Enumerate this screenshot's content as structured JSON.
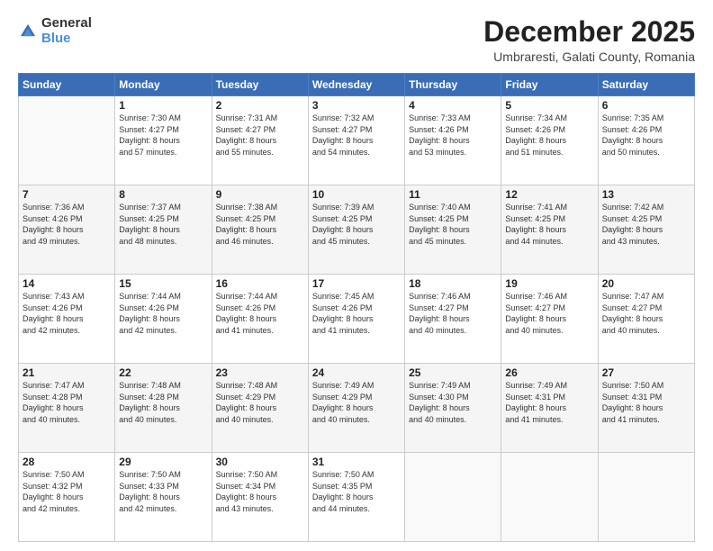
{
  "logo": {
    "general": "General",
    "blue": "Blue"
  },
  "title": "December 2025",
  "location": "Umbraresti, Galati County, Romania",
  "weekdays": [
    "Sunday",
    "Monday",
    "Tuesday",
    "Wednesday",
    "Thursday",
    "Friday",
    "Saturday"
  ],
  "weeks": [
    [
      {
        "day": "",
        "info": ""
      },
      {
        "day": "1",
        "info": "Sunrise: 7:30 AM\nSunset: 4:27 PM\nDaylight: 8 hours\nand 57 minutes."
      },
      {
        "day": "2",
        "info": "Sunrise: 7:31 AM\nSunset: 4:27 PM\nDaylight: 8 hours\nand 55 minutes."
      },
      {
        "day": "3",
        "info": "Sunrise: 7:32 AM\nSunset: 4:27 PM\nDaylight: 8 hours\nand 54 minutes."
      },
      {
        "day": "4",
        "info": "Sunrise: 7:33 AM\nSunset: 4:26 PM\nDaylight: 8 hours\nand 53 minutes."
      },
      {
        "day": "5",
        "info": "Sunrise: 7:34 AM\nSunset: 4:26 PM\nDaylight: 8 hours\nand 51 minutes."
      },
      {
        "day": "6",
        "info": "Sunrise: 7:35 AM\nSunset: 4:26 PM\nDaylight: 8 hours\nand 50 minutes."
      }
    ],
    [
      {
        "day": "7",
        "info": "Sunrise: 7:36 AM\nSunset: 4:26 PM\nDaylight: 8 hours\nand 49 minutes."
      },
      {
        "day": "8",
        "info": "Sunrise: 7:37 AM\nSunset: 4:25 PM\nDaylight: 8 hours\nand 48 minutes."
      },
      {
        "day": "9",
        "info": "Sunrise: 7:38 AM\nSunset: 4:25 PM\nDaylight: 8 hours\nand 46 minutes."
      },
      {
        "day": "10",
        "info": "Sunrise: 7:39 AM\nSunset: 4:25 PM\nDaylight: 8 hours\nand 45 minutes."
      },
      {
        "day": "11",
        "info": "Sunrise: 7:40 AM\nSunset: 4:25 PM\nDaylight: 8 hours\nand 45 minutes."
      },
      {
        "day": "12",
        "info": "Sunrise: 7:41 AM\nSunset: 4:25 PM\nDaylight: 8 hours\nand 44 minutes."
      },
      {
        "day": "13",
        "info": "Sunrise: 7:42 AM\nSunset: 4:25 PM\nDaylight: 8 hours\nand 43 minutes."
      }
    ],
    [
      {
        "day": "14",
        "info": "Sunrise: 7:43 AM\nSunset: 4:26 PM\nDaylight: 8 hours\nand 42 minutes."
      },
      {
        "day": "15",
        "info": "Sunrise: 7:44 AM\nSunset: 4:26 PM\nDaylight: 8 hours\nand 42 minutes."
      },
      {
        "day": "16",
        "info": "Sunrise: 7:44 AM\nSunset: 4:26 PM\nDaylight: 8 hours\nand 41 minutes."
      },
      {
        "day": "17",
        "info": "Sunrise: 7:45 AM\nSunset: 4:26 PM\nDaylight: 8 hours\nand 41 minutes."
      },
      {
        "day": "18",
        "info": "Sunrise: 7:46 AM\nSunset: 4:27 PM\nDaylight: 8 hours\nand 40 minutes."
      },
      {
        "day": "19",
        "info": "Sunrise: 7:46 AM\nSunset: 4:27 PM\nDaylight: 8 hours\nand 40 minutes."
      },
      {
        "day": "20",
        "info": "Sunrise: 7:47 AM\nSunset: 4:27 PM\nDaylight: 8 hours\nand 40 minutes."
      }
    ],
    [
      {
        "day": "21",
        "info": "Sunrise: 7:47 AM\nSunset: 4:28 PM\nDaylight: 8 hours\nand 40 minutes."
      },
      {
        "day": "22",
        "info": "Sunrise: 7:48 AM\nSunset: 4:28 PM\nDaylight: 8 hours\nand 40 minutes."
      },
      {
        "day": "23",
        "info": "Sunrise: 7:48 AM\nSunset: 4:29 PM\nDaylight: 8 hours\nand 40 minutes."
      },
      {
        "day": "24",
        "info": "Sunrise: 7:49 AM\nSunset: 4:29 PM\nDaylight: 8 hours\nand 40 minutes."
      },
      {
        "day": "25",
        "info": "Sunrise: 7:49 AM\nSunset: 4:30 PM\nDaylight: 8 hours\nand 40 minutes."
      },
      {
        "day": "26",
        "info": "Sunrise: 7:49 AM\nSunset: 4:31 PM\nDaylight: 8 hours\nand 41 minutes."
      },
      {
        "day": "27",
        "info": "Sunrise: 7:50 AM\nSunset: 4:31 PM\nDaylight: 8 hours\nand 41 minutes."
      }
    ],
    [
      {
        "day": "28",
        "info": "Sunrise: 7:50 AM\nSunset: 4:32 PM\nDaylight: 8 hours\nand 42 minutes."
      },
      {
        "day": "29",
        "info": "Sunrise: 7:50 AM\nSunset: 4:33 PM\nDaylight: 8 hours\nand 42 minutes."
      },
      {
        "day": "30",
        "info": "Sunrise: 7:50 AM\nSunset: 4:34 PM\nDaylight: 8 hours\nand 43 minutes."
      },
      {
        "day": "31",
        "info": "Sunrise: 7:50 AM\nSunset: 4:35 PM\nDaylight: 8 hours\nand 44 minutes."
      },
      {
        "day": "",
        "info": ""
      },
      {
        "day": "",
        "info": ""
      },
      {
        "day": "",
        "info": ""
      }
    ]
  ]
}
